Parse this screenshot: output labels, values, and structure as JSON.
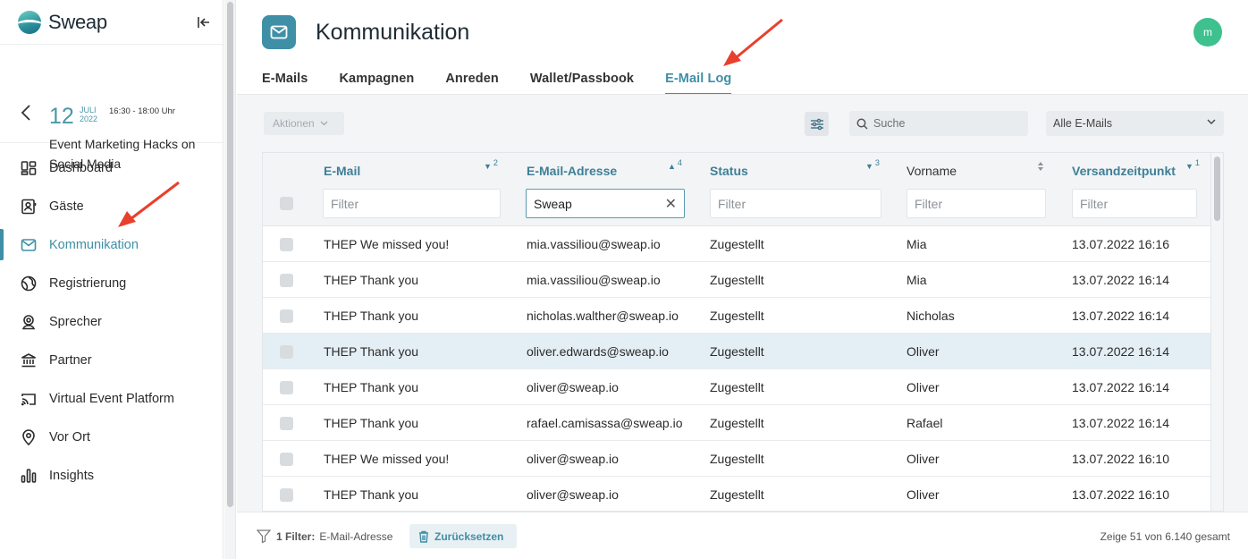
{
  "brand": {
    "name": "Sweap"
  },
  "event": {
    "day": "12",
    "month": "JULI",
    "year": "2022",
    "time": "16:30 - 18:00 Uhr",
    "title": "Event Marketing Hacks on Social Media"
  },
  "nav": [
    {
      "label": "Dashboard",
      "icon": "dashboard-icon"
    },
    {
      "label": "Gäste",
      "icon": "guests-icon"
    },
    {
      "label": "Kommunikation",
      "icon": "mail-icon",
      "active": true
    },
    {
      "label": "Registrierung",
      "icon": "globe-icon"
    },
    {
      "label": "Sprecher",
      "icon": "speaker-icon"
    },
    {
      "label": "Partner",
      "icon": "bank-icon"
    },
    {
      "label": "Virtual Event Platform",
      "icon": "cast-icon"
    },
    {
      "label": "Vor Ort",
      "icon": "location-pin-icon"
    },
    {
      "label": "Insights",
      "icon": "bar-chart-icon"
    }
  ],
  "header": {
    "title": "Kommunikation",
    "avatar": "m"
  },
  "tabs": [
    {
      "label": "E-Mails"
    },
    {
      "label": "Kampagnen"
    },
    {
      "label": "Anreden"
    },
    {
      "label": "Wallet/Passbook"
    },
    {
      "label": "E-Mail Log",
      "active": true
    }
  ],
  "toolbar": {
    "actions_label": "Aktionen",
    "search_placeholder": "Suche",
    "select_value": "Alle E-Mails"
  },
  "table": {
    "columns": [
      {
        "label": "E-Mail",
        "sort": "▼",
        "order": "2",
        "filter_placeholder": "Filter",
        "filter_value": ""
      },
      {
        "label": "E-Mail-Adresse",
        "sort": "▲",
        "order": "4",
        "filter_placeholder": "Filter",
        "filter_value": "Sweap"
      },
      {
        "label": "Status",
        "sort": "▼",
        "order": "3",
        "filter_placeholder": "Filter",
        "filter_value": ""
      },
      {
        "label": "Vorname",
        "sort": "",
        "order": "",
        "filter_placeholder": "Filter",
        "filter_value": ""
      },
      {
        "label": "Versandzeitpunkt",
        "sort": "▼",
        "order": "1",
        "filter_placeholder": "Filter",
        "filter_value": ""
      }
    ],
    "rows": [
      [
        "THEP We missed you!",
        "mia.vassiliou@sweap.io",
        "Zugestellt",
        "Mia",
        "13.07.2022 16:16"
      ],
      [
        "THEP Thank you",
        "mia.vassiliou@sweap.io",
        "Zugestellt",
        "Mia",
        "13.07.2022 16:14"
      ],
      [
        "THEP Thank you",
        "nicholas.walther@sweap.io",
        "Zugestellt",
        "Nicholas",
        "13.07.2022 16:14"
      ],
      [
        "THEP Thank you",
        "oliver.edwards@sweap.io",
        "Zugestellt",
        "Oliver",
        "13.07.2022 16:14"
      ],
      [
        "THEP Thank you",
        "oliver@sweap.io",
        "Zugestellt",
        "Oliver",
        "13.07.2022 16:14"
      ],
      [
        "THEP Thank you",
        "rafael.camisassa@sweap.io",
        "Zugestellt",
        "Rafael",
        "13.07.2022 16:14"
      ],
      [
        "THEP We missed you!",
        "oliver@sweap.io",
        "Zugestellt",
        "Oliver",
        "13.07.2022 16:10"
      ],
      [
        "THEP Thank you",
        "oliver@sweap.io",
        "Zugestellt",
        "Oliver",
        "13.07.2022 16:10"
      ]
    ],
    "highlighted_row": 3
  },
  "footer": {
    "filter_count": "1 Filter:",
    "filter_field": "E-Mail-Adresse",
    "reset_label": "Zurücksetzen",
    "summary": "Zeige 51 von 6.140 gesamt"
  },
  "colors": {
    "accent": "#3f8fa6",
    "annotation_arrow": "#e8402c",
    "avatar": "#3ec08f"
  }
}
